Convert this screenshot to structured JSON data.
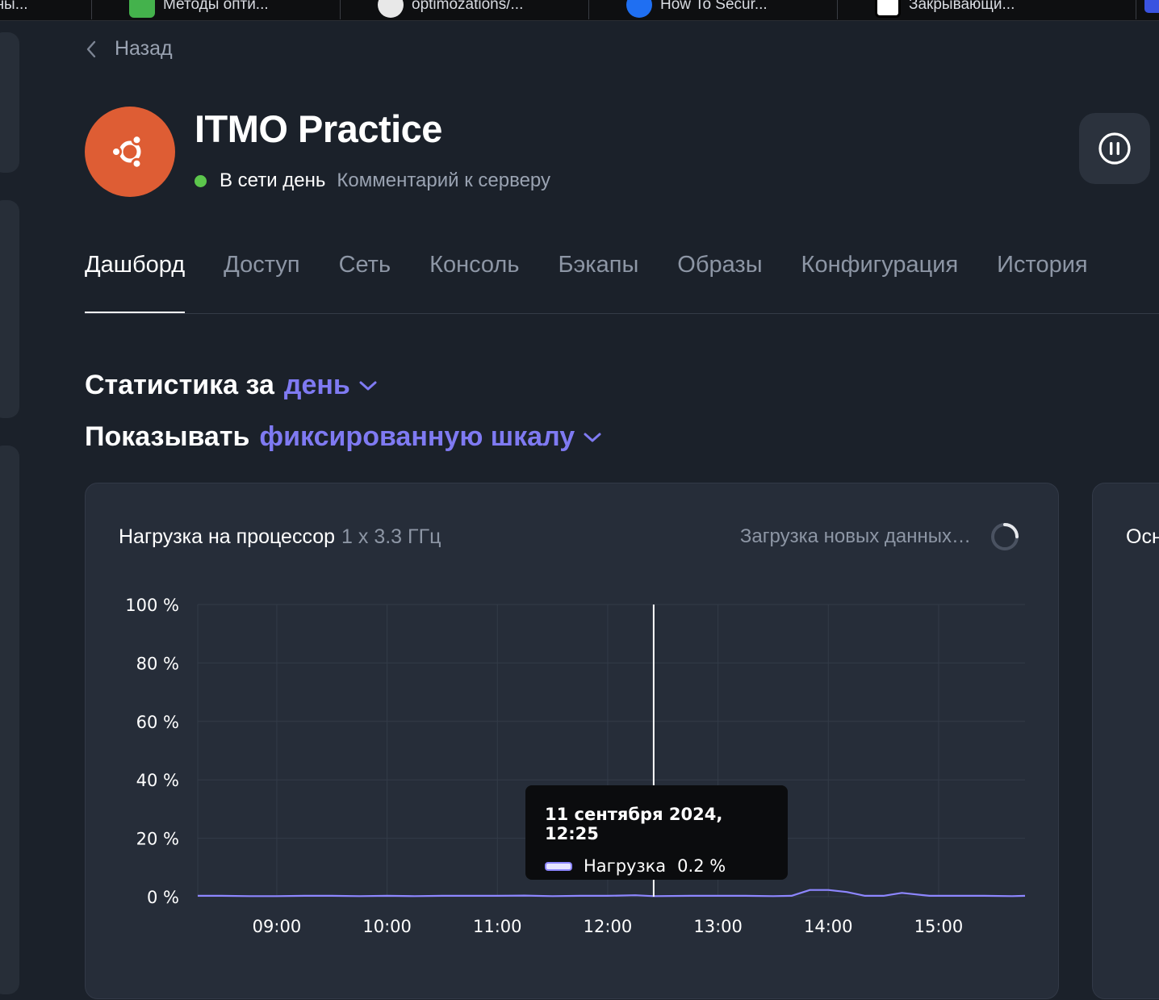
{
  "browser_tabs": [
    {
      "label": "рны..."
    },
    {
      "label": "Методы опти...",
      "color": "#44b24c"
    },
    {
      "label": "optimozations/...",
      "color": "#e8e8e8"
    },
    {
      "label": "How To Secur...",
      "color": "#1f6ff2"
    },
    {
      "label": "Закрывающи...",
      "color": "#ffffff"
    }
  ],
  "nav": {
    "back_label": "Назад"
  },
  "server": {
    "name": "ITMO Practice",
    "status": "В сети день",
    "comment": "Комментарий к серверу",
    "avatar_icon": "ubuntu-logo-icon",
    "avatar_color": "#de5d34",
    "status_color": "#5cc64c"
  },
  "actions": {
    "pause_icon": "pause-icon"
  },
  "tabs": [
    {
      "label": "Дашборд",
      "active": true
    },
    {
      "label": "Доступ"
    },
    {
      "label": "Сеть"
    },
    {
      "label": "Консоль"
    },
    {
      "label": "Бэкапы"
    },
    {
      "label": "Образы"
    },
    {
      "label": "Конфигурация"
    },
    {
      "label": "История"
    }
  ],
  "stats": {
    "period_prefix": "Статистика за",
    "period_value": "день",
    "scale_prefix": "Показывать",
    "scale_value": "фиксированную шкалу",
    "accent": "#7f7af2"
  },
  "cpu_card": {
    "title": "Нагрузка на процессор",
    "subtitle": "1 x 3.3 ГГц",
    "loading_text": "Загрузка новых данных…"
  },
  "second_card": {
    "title_visible": "Осн"
  },
  "tooltip": {
    "date": "11 сентября 2024, 12:25",
    "series_label": "Нагрузка",
    "value": "0.2 %"
  },
  "chart_data": {
    "type": "line",
    "xlabel": "",
    "ylabel": "",
    "ylim": [
      0,
      100
    ],
    "y_ticks": [
      "100 %",
      "80 %",
      "60 %",
      "40 %",
      "20 %",
      "0 %"
    ],
    "x_ticks": [
      "09:00",
      "10:00",
      "11:00",
      "12:00",
      "13:00",
      "14:00",
      "15:00"
    ],
    "series": [
      {
        "color": "#8d86ff",
        "x": [
          "08:17",
          "08:30",
          "08:45",
          "09:00",
          "09:15",
          "09:30",
          "09:45",
          "10:00",
          "10:15",
          "10:30",
          "10:45",
          "11:00",
          "11:15",
          "11:30",
          "11:45",
          "12:00",
          "12:15",
          "12:25",
          "12:45",
          "13:00",
          "13:15",
          "13:30",
          "13:40",
          "13:50",
          "14:00",
          "14:10",
          "14:20",
          "14:30",
          "14:40",
          "14:55",
          "15:10",
          "15:25",
          "15:40",
          "15:47"
        ],
        "values": [
          0.3,
          0.3,
          0.2,
          0.2,
          0.3,
          0.3,
          0.2,
          0.3,
          0.2,
          0.3,
          0.3,
          0.3,
          0.4,
          0.2,
          0.3,
          0.3,
          0.5,
          0.2,
          0.3,
          0.3,
          0.3,
          0.2,
          0.3,
          2.3,
          2.3,
          1.6,
          0.3,
          0.3,
          1.3,
          0.3,
          0.3,
          0.3,
          0.2,
          0.3
        ]
      }
    ],
    "cursor_x": "12:25"
  }
}
